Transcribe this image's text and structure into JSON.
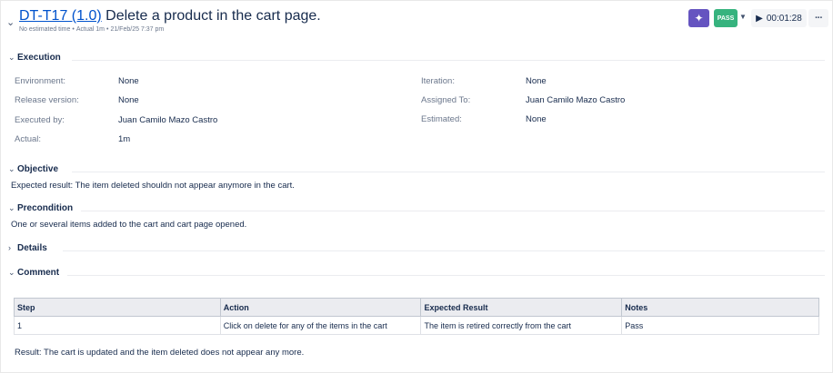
{
  "header": {
    "collapse_icon": "chevron-down-icon",
    "key": "DT-T17 (1.0)",
    "title": "Delete a product in the cart page.",
    "meta_estimated": "No estimated time",
    "meta_actual": "Actual 1m",
    "meta_date": "21/Feb/25 7:37 pm",
    "ai_icon": "sparkle-icon",
    "status": "PASS",
    "timer": "00:01:28",
    "more": "···"
  },
  "sections": {
    "execution": "Execution",
    "objective": "Objective",
    "precondition": "Precondition",
    "details": "Details",
    "comment": "Comment"
  },
  "execution": {
    "environment_label": "Environment:",
    "environment_value": "None",
    "release_label": "Release version:",
    "release_value": "None",
    "executed_by_label": "Executed by:",
    "executed_by_value": "Juan Camilo Mazo Castro",
    "actual_label": "Actual:",
    "actual_value": "1m",
    "iteration_label": "Iteration:",
    "iteration_value": "None",
    "assigned_label": "Assigned To:",
    "assigned_value": "Juan Camilo Mazo Castro",
    "estimated_label": "Estimated:",
    "estimated_value": "None"
  },
  "objective": {
    "text": "Expected result: The item deleted shouldn not appear anymore in the cart."
  },
  "precondition": {
    "text": "One or several items added to the cart and cart page opened."
  },
  "comment": {
    "table": {
      "headers": [
        "Step",
        "Action",
        "Expected Result",
        "Notes"
      ],
      "rows": [
        [
          "1",
          "Click on delete for any of the items in the cart",
          "The item is retired correctly from the cart",
          "Pass"
        ]
      ]
    },
    "result": "Result: The cart is updated and the item deleted does not appear any more."
  },
  "colors": {
    "link": "#0052cc",
    "pass": "#36b37e",
    "ai": "#6554c0"
  }
}
